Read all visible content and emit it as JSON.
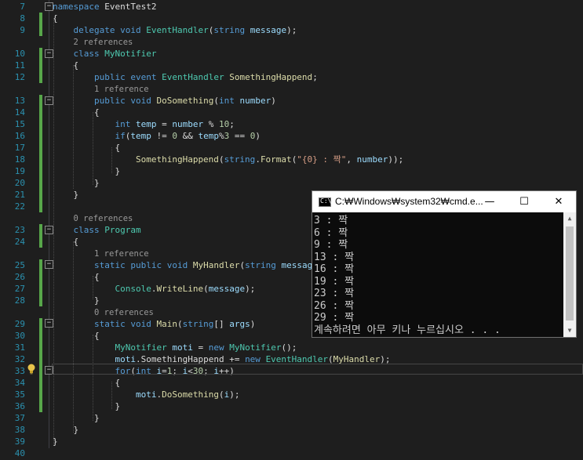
{
  "editor": {
    "lines": [
      {
        "num": "7",
        "tokens": [
          {
            "c": "kw",
            "t": "namespace"
          },
          {
            "c": "",
            "t": " EventTest2"
          }
        ]
      },
      {
        "num": "8",
        "tokens": [
          {
            "c": "",
            "t": "{"
          }
        ]
      },
      {
        "num": "9",
        "tokens": [
          {
            "c": "",
            "t": "    "
          },
          {
            "c": "kw",
            "t": "delegate"
          },
          {
            "c": "",
            "t": " "
          },
          {
            "c": "kw",
            "t": "void"
          },
          {
            "c": "",
            "t": " "
          },
          {
            "c": "ty",
            "t": "EventHandler"
          },
          {
            "c": "",
            "t": "("
          },
          {
            "c": "kw",
            "t": "string"
          },
          {
            "c": "",
            "t": " "
          },
          {
            "c": "pm",
            "t": "message"
          },
          {
            "c": "",
            "t": ");"
          }
        ]
      },
      {
        "num": "",
        "ref": "2 references",
        "indent": "    "
      },
      {
        "num": "10",
        "tokens": [
          {
            "c": "",
            "t": "    "
          },
          {
            "c": "kw",
            "t": "class"
          },
          {
            "c": "",
            "t": " "
          },
          {
            "c": "ty",
            "t": "MyNotifier"
          }
        ]
      },
      {
        "num": "11",
        "tokens": [
          {
            "c": "",
            "t": "    {"
          }
        ]
      },
      {
        "num": "12",
        "tokens": [
          {
            "c": "",
            "t": "        "
          },
          {
            "c": "kw",
            "t": "public"
          },
          {
            "c": "",
            "t": " "
          },
          {
            "c": "kw",
            "t": "event"
          },
          {
            "c": "",
            "t": " "
          },
          {
            "c": "ty",
            "t": "EventHandler"
          },
          {
            "c": "",
            "t": " "
          },
          {
            "c": "mt",
            "t": "SomethingHappend"
          },
          {
            "c": "",
            "t": ";"
          }
        ]
      },
      {
        "num": "",
        "ref": "1 reference",
        "indent": "        "
      },
      {
        "num": "13",
        "tokens": [
          {
            "c": "",
            "t": "        "
          },
          {
            "c": "kw",
            "t": "public"
          },
          {
            "c": "",
            "t": " "
          },
          {
            "c": "kw",
            "t": "void"
          },
          {
            "c": "",
            "t": " "
          },
          {
            "c": "mt",
            "t": "DoSomething"
          },
          {
            "c": "",
            "t": "("
          },
          {
            "c": "kw",
            "t": "int"
          },
          {
            "c": "",
            "t": " "
          },
          {
            "c": "pm",
            "t": "number"
          },
          {
            "c": "",
            "t": ")"
          }
        ]
      },
      {
        "num": "14",
        "tokens": [
          {
            "c": "",
            "t": "        {"
          }
        ]
      },
      {
        "num": "15",
        "tokens": [
          {
            "c": "",
            "t": "            "
          },
          {
            "c": "kw",
            "t": "int"
          },
          {
            "c": "",
            "t": " "
          },
          {
            "c": "pm",
            "t": "temp"
          },
          {
            "c": "",
            "t": " = "
          },
          {
            "c": "pm",
            "t": "number"
          },
          {
            "c": "",
            "t": " % "
          },
          {
            "c": "nu",
            "t": "10"
          },
          {
            "c": "",
            "t": ";"
          }
        ]
      },
      {
        "num": "16",
        "tokens": [
          {
            "c": "",
            "t": "            "
          },
          {
            "c": "kw",
            "t": "if"
          },
          {
            "c": "",
            "t": "("
          },
          {
            "c": "pm",
            "t": "temp"
          },
          {
            "c": "",
            "t": " != "
          },
          {
            "c": "nu",
            "t": "0"
          },
          {
            "c": "",
            "t": " && "
          },
          {
            "c": "pm",
            "t": "temp"
          },
          {
            "c": "",
            "t": "%"
          },
          {
            "c": "nu",
            "t": "3"
          },
          {
            "c": "",
            "t": " == "
          },
          {
            "c": "nu",
            "t": "0"
          },
          {
            "c": "",
            "t": ")"
          }
        ]
      },
      {
        "num": "17",
        "tokens": [
          {
            "c": "",
            "t": "            {"
          }
        ]
      },
      {
        "num": "18",
        "tokens": [
          {
            "c": "",
            "t": "                "
          },
          {
            "c": "mt",
            "t": "SomethingHappend"
          },
          {
            "c": "",
            "t": "("
          },
          {
            "c": "kw",
            "t": "string"
          },
          {
            "c": "",
            "t": "."
          },
          {
            "c": "mt",
            "t": "Format"
          },
          {
            "c": "",
            "t": "("
          },
          {
            "c": "st",
            "t": "\"{0} : 짝\""
          },
          {
            "c": "",
            "t": ", "
          },
          {
            "c": "pm",
            "t": "number"
          },
          {
            "c": "",
            "t": "));"
          }
        ]
      },
      {
        "num": "19",
        "tokens": [
          {
            "c": "",
            "t": "            }"
          }
        ]
      },
      {
        "num": "20",
        "tokens": [
          {
            "c": "",
            "t": "        }"
          }
        ]
      },
      {
        "num": "21",
        "tokens": [
          {
            "c": "",
            "t": "    }"
          }
        ]
      },
      {
        "num": "22",
        "tokens": []
      },
      {
        "num": "",
        "ref": "0 references",
        "indent": "    "
      },
      {
        "num": "23",
        "tokens": [
          {
            "c": "",
            "t": "    "
          },
          {
            "c": "kw",
            "t": "class"
          },
          {
            "c": "",
            "t": " "
          },
          {
            "c": "ty",
            "t": "Program"
          }
        ]
      },
      {
        "num": "24",
        "tokens": [
          {
            "c": "",
            "t": "    {"
          }
        ]
      },
      {
        "num": "",
        "ref": "1 reference",
        "indent": "        "
      },
      {
        "num": "25",
        "tokens": [
          {
            "c": "",
            "t": "        "
          },
          {
            "c": "kw",
            "t": "static"
          },
          {
            "c": "",
            "t": " "
          },
          {
            "c": "kw",
            "t": "public"
          },
          {
            "c": "",
            "t": " "
          },
          {
            "c": "kw",
            "t": "void"
          },
          {
            "c": "",
            "t": " "
          },
          {
            "c": "mt",
            "t": "MyHandler"
          },
          {
            "c": "",
            "t": "("
          },
          {
            "c": "kw",
            "t": "string"
          },
          {
            "c": "",
            "t": " "
          },
          {
            "c": "pm",
            "t": "message"
          },
          {
            "c": "",
            "t": ")"
          }
        ]
      },
      {
        "num": "26",
        "tokens": [
          {
            "c": "",
            "t": "        {"
          }
        ]
      },
      {
        "num": "27",
        "tokens": [
          {
            "c": "",
            "t": "            "
          },
          {
            "c": "ty",
            "t": "Console"
          },
          {
            "c": "",
            "t": "."
          },
          {
            "c": "mt",
            "t": "WriteLine"
          },
          {
            "c": "",
            "t": "("
          },
          {
            "c": "pm",
            "t": "message"
          },
          {
            "c": "",
            "t": ");"
          }
        ]
      },
      {
        "num": "28",
        "tokens": [
          {
            "c": "",
            "t": "        }"
          }
        ]
      },
      {
        "num": "",
        "ref": "0 references",
        "indent": "        "
      },
      {
        "num": "29",
        "tokens": [
          {
            "c": "",
            "t": "        "
          },
          {
            "c": "kw",
            "t": "static"
          },
          {
            "c": "",
            "t": " "
          },
          {
            "c": "kw",
            "t": "void"
          },
          {
            "c": "",
            "t": " "
          },
          {
            "c": "mt",
            "t": "Main"
          },
          {
            "c": "",
            "t": "("
          },
          {
            "c": "kw",
            "t": "string"
          },
          {
            "c": "",
            "t": "[] "
          },
          {
            "c": "pm",
            "t": "args"
          },
          {
            "c": "",
            "t": ")"
          }
        ]
      },
      {
        "num": "30",
        "tokens": [
          {
            "c": "",
            "t": "        {"
          }
        ]
      },
      {
        "num": "31",
        "tokens": [
          {
            "c": "",
            "t": "            "
          },
          {
            "c": "ty",
            "t": "MyNotifier"
          },
          {
            "c": "",
            "t": " "
          },
          {
            "c": "pm",
            "t": "moti"
          },
          {
            "c": "",
            "t": " = "
          },
          {
            "c": "kw",
            "t": "new"
          },
          {
            "c": "",
            "t": " "
          },
          {
            "c": "ty",
            "t": "MyNotifier"
          },
          {
            "c": "",
            "t": "();"
          }
        ]
      },
      {
        "num": "32",
        "tokens": [
          {
            "c": "",
            "t": "            "
          },
          {
            "c": "pm",
            "t": "moti"
          },
          {
            "c": "",
            "t": "."
          },
          {
            "c": "",
            "t": "SomethingHappend += "
          },
          {
            "c": "kw",
            "t": "new"
          },
          {
            "c": "",
            "t": " "
          },
          {
            "c": "ty",
            "t": "EventHandler"
          },
          {
            "c": "",
            "t": "("
          },
          {
            "c": "mt",
            "t": "MyHandler"
          },
          {
            "c": "",
            "t": ");"
          }
        ]
      },
      {
        "num": "33",
        "tokens": [
          {
            "c": "",
            "t": "            "
          },
          {
            "c": "kw",
            "t": "for"
          },
          {
            "c": "",
            "t": "("
          },
          {
            "c": "kw",
            "t": "int"
          },
          {
            "c": "",
            "t": " "
          },
          {
            "c": "pm",
            "t": "i"
          },
          {
            "c": "",
            "t": "="
          },
          {
            "c": "nu",
            "t": "1"
          },
          {
            "c": "",
            "t": "; "
          },
          {
            "c": "pm",
            "t": "i"
          },
          {
            "c": "",
            "t": "<"
          },
          {
            "c": "nu",
            "t": "30"
          },
          {
            "c": "",
            "t": "; "
          },
          {
            "c": "pm",
            "t": "i"
          },
          {
            "c": "",
            "t": "++)"
          }
        ]
      },
      {
        "num": "34",
        "tokens": [
          {
            "c": "",
            "t": "            {"
          }
        ]
      },
      {
        "num": "35",
        "tokens": [
          {
            "c": "",
            "t": "                "
          },
          {
            "c": "pm",
            "t": "moti"
          },
          {
            "c": "",
            "t": "."
          },
          {
            "c": "mt",
            "t": "DoSomething"
          },
          {
            "c": "",
            "t": "("
          },
          {
            "c": "pm",
            "t": "i"
          },
          {
            "c": "",
            "t": ");"
          }
        ]
      },
      {
        "num": "36",
        "tokens": [
          {
            "c": "",
            "t": "            }"
          }
        ]
      },
      {
        "num": "37",
        "tokens": [
          {
            "c": "",
            "t": "        }"
          }
        ]
      },
      {
        "num": "38",
        "tokens": [
          {
            "c": "",
            "t": "    }"
          }
        ]
      },
      {
        "num": "39",
        "tokens": [
          {
            "c": "",
            "t": "}"
          }
        ]
      },
      {
        "num": "40",
        "tokens": []
      }
    ]
  },
  "console": {
    "title": "C:₩Windows₩system32₩cmd.e...",
    "minimize": "—",
    "maximize": "☐",
    "close": "✕",
    "lines": [
      "3 : 짝",
      "6 : 짝",
      "9 : 짝",
      "13 : 짝",
      "16 : 짝",
      "19 : 짝",
      "23 : 짝",
      "26 : 짝",
      "29 : 짝",
      "계속하려면 아무 키나 누르십시오 . . ."
    ]
  },
  "colors": {
    "background": "#1e1e1e",
    "line_number": "#2b91af",
    "keyword": "#569cd6",
    "type": "#4ec9b0",
    "method": "#dcdcaa",
    "change_marker": "#57a64a"
  },
  "icons": {
    "lightbulb": "lightbulb-icon",
    "console_app": "cmd-icon"
  }
}
